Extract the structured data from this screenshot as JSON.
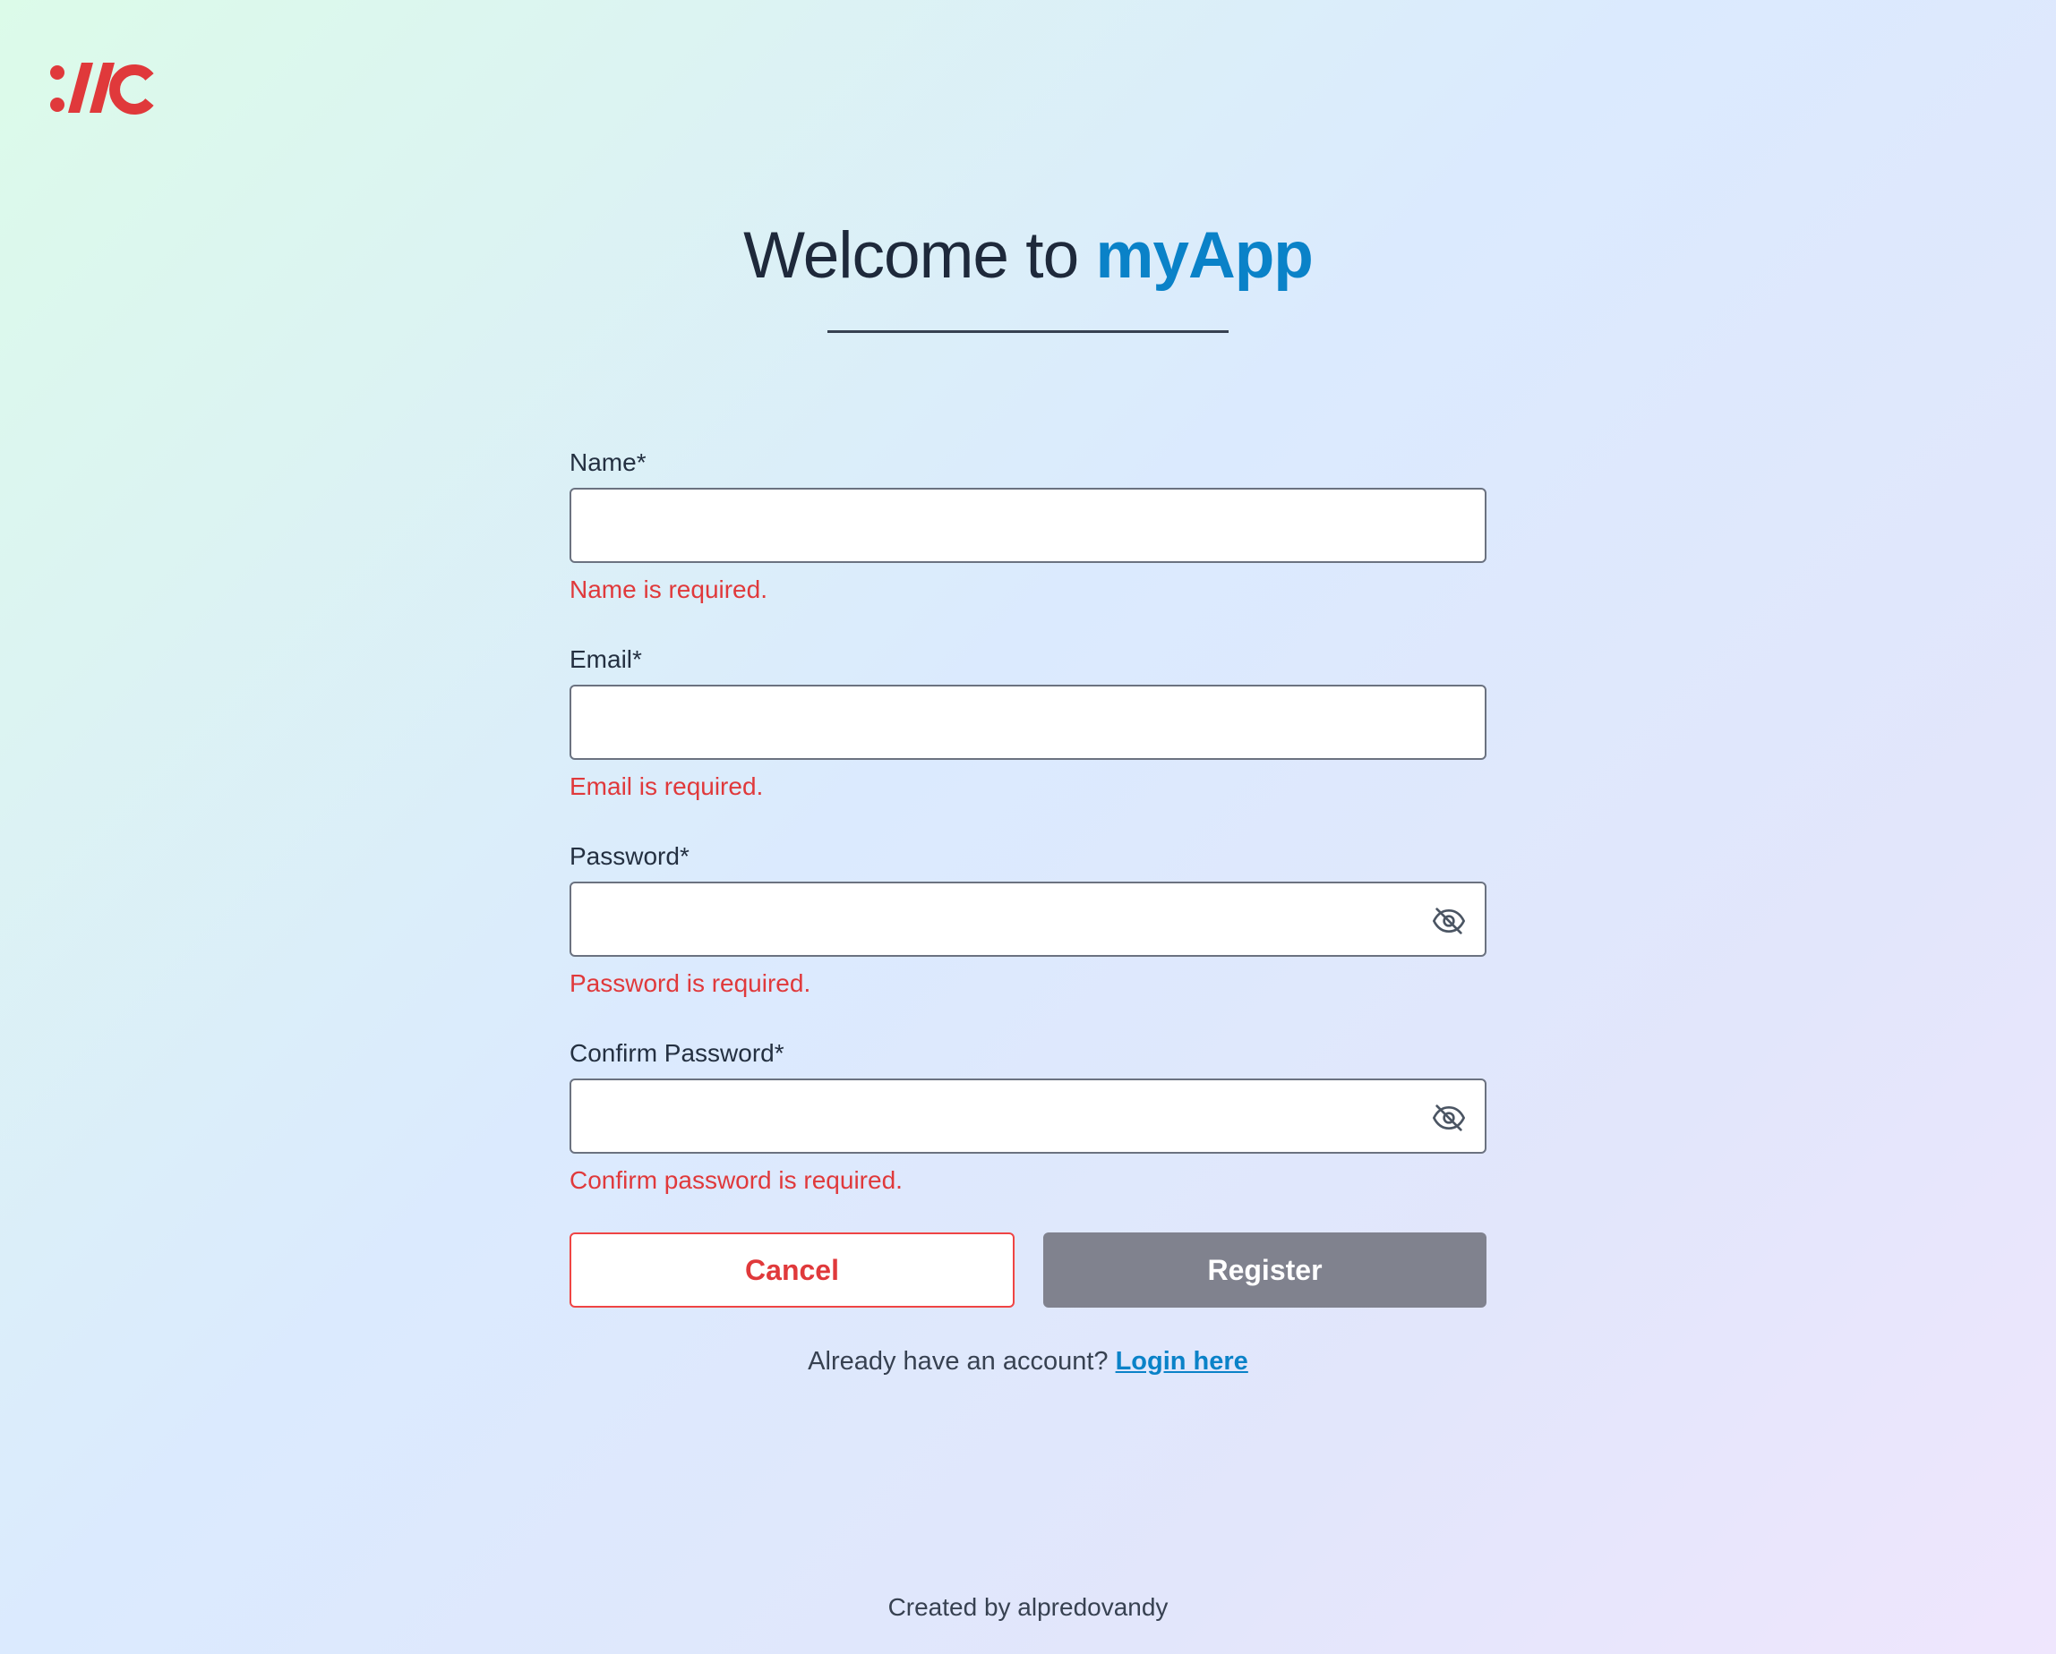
{
  "logo": {
    "alt": "app logo",
    "color": "#e0393b"
  },
  "header": {
    "title_prefix": "Welcome to ",
    "title_brand": "myApp",
    "brand_color": "#0a82c8"
  },
  "form": {
    "name": {
      "label": "Name*",
      "value": "",
      "error": "Name is required."
    },
    "email": {
      "label": "Email*",
      "value": "",
      "error": "Email is required."
    },
    "password": {
      "label": "Password*",
      "value": "",
      "error": "Password is required.",
      "icon": "eye-off-icon"
    },
    "confirm_password": {
      "label": "Confirm Password*",
      "value": "",
      "error": "Confirm password is required.",
      "icon": "eye-off-icon"
    },
    "error_color": "#e0393b"
  },
  "buttons": {
    "cancel_label": "Cancel",
    "register_label": "Register",
    "register_color": "#80828e"
  },
  "login_prompt": {
    "text": "Already have an account? ",
    "link_label": "Login here"
  },
  "footer": {
    "text": "Created by alpredovandy"
  }
}
